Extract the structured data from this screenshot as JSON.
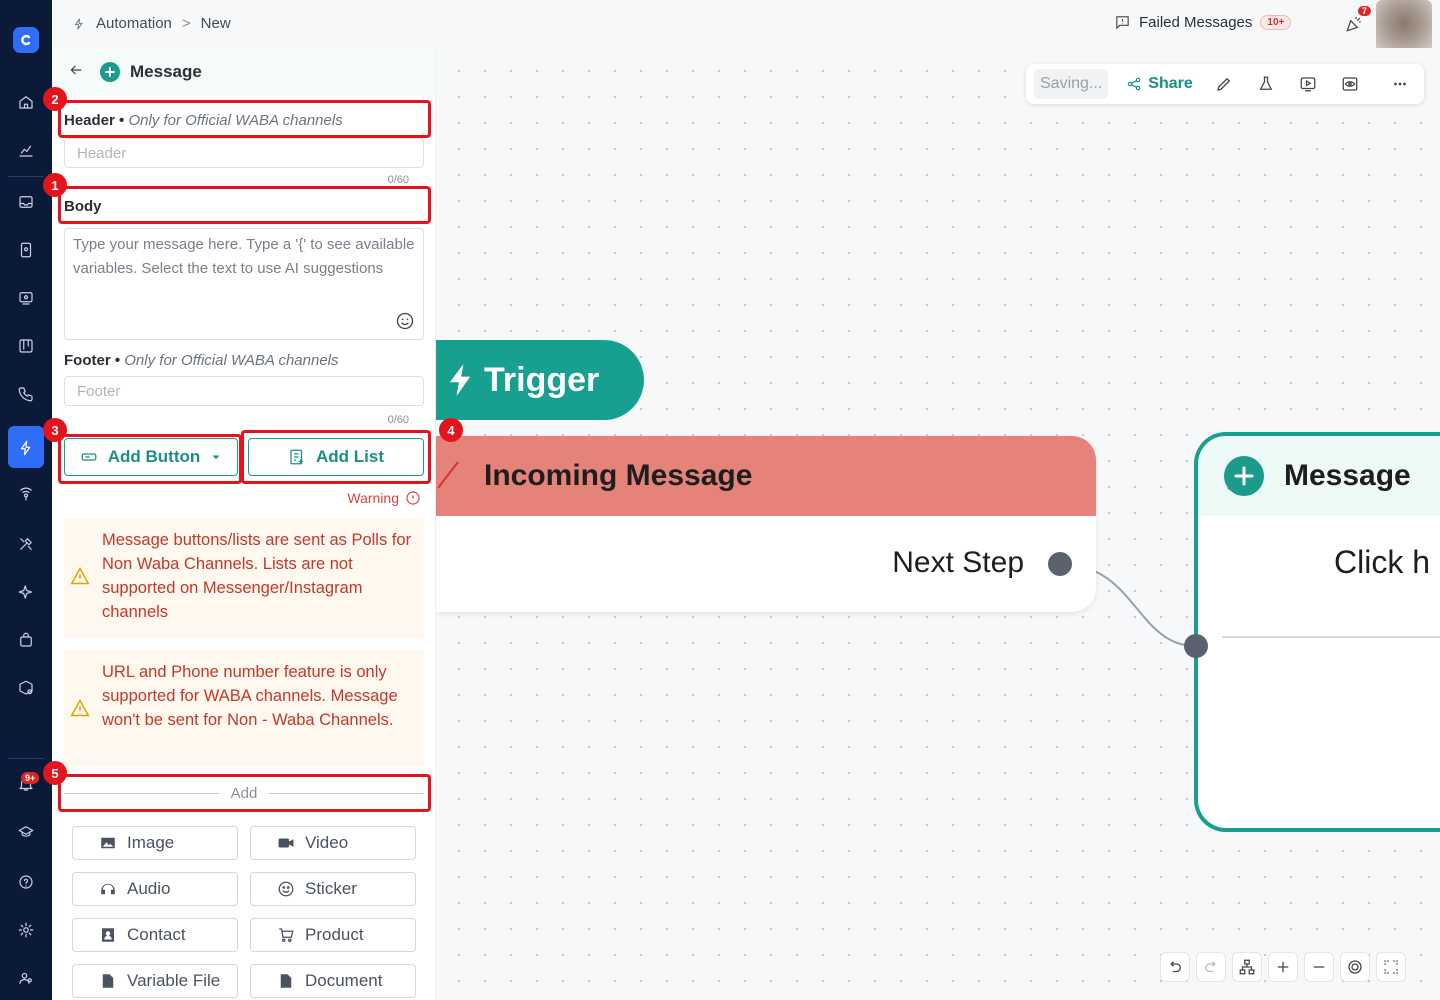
{
  "colors": {
    "accent": "#1b9b8b",
    "rail": "#0c1a3a",
    "rail_active": "#2f6df6",
    "trigger": "#179f8f",
    "incoming_header": "#e5837b",
    "warning_bg": "#fff8ee",
    "warning_text": "#c0392b",
    "annotation": "#e3141b"
  },
  "breadcrumb": {
    "root": "Automation",
    "current": "New"
  },
  "topbar": {
    "failed_label": "Failed Messages",
    "failed_count": "10+",
    "notification_count": "7"
  },
  "rail": {
    "icons": [
      "home-icon",
      "analytics-icon",
      "inbox-icon",
      "contacts-icon",
      "broadcast-icon",
      "board-icon",
      "phone-icon",
      "automation-icon",
      "signal-icon",
      "tools-icon",
      "ai-sparkle-icon",
      "commerce-icon",
      "settings-cube-icon",
      "bell-icon",
      "academy-icon",
      "help-icon",
      "gear-icon",
      "team-icon"
    ],
    "bell_badge": "9+"
  },
  "panel": {
    "title": "Message",
    "header_label": "Header",
    "header_note": "Only for Official WABA channels",
    "header_placeholder": "Header",
    "header_counter": "0/60",
    "body_label": "Body",
    "body_placeholder": "Type your message here. Type a '{' to see available variables. Select the text to use AI suggestions",
    "footer_label": "Footer",
    "footer_note": "Only for Official WABA channels",
    "footer_placeholder": "Footer",
    "footer_counter": "0/60",
    "add_button": "Add Button",
    "add_list": "Add List",
    "warning_link": "Warning",
    "warnings": [
      "Message buttons/lists are sent as Polls for Non Waba Channels. Lists are not supported on Messenger/Instagram channels",
      "URL and Phone number feature is only supported for WABA channels. Message won't be sent for Non - Waba Channels."
    ],
    "add_separator": "Add",
    "add_items": [
      {
        "label": "Image",
        "icon": "image-icon"
      },
      {
        "label": "Video",
        "icon": "video-icon"
      },
      {
        "label": "Audio",
        "icon": "headphones-icon"
      },
      {
        "label": "Sticker",
        "icon": "sticker-icon"
      },
      {
        "label": "Contact",
        "icon": "contact-card-icon"
      },
      {
        "label": "Product",
        "icon": "cart-icon"
      },
      {
        "label": "Variable File",
        "icon": "file-icon"
      },
      {
        "label": "Document",
        "icon": "document-icon"
      }
    ]
  },
  "toolbar": {
    "saving": "Saving...",
    "share": "Share"
  },
  "canvas": {
    "trigger_label": "Trigger",
    "incoming_title": "Incoming Message",
    "next_step": "Next Step",
    "message_title": "Message",
    "message_body": "Click h"
  },
  "annotations": [
    "1",
    "2",
    "3",
    "4",
    "5"
  ]
}
